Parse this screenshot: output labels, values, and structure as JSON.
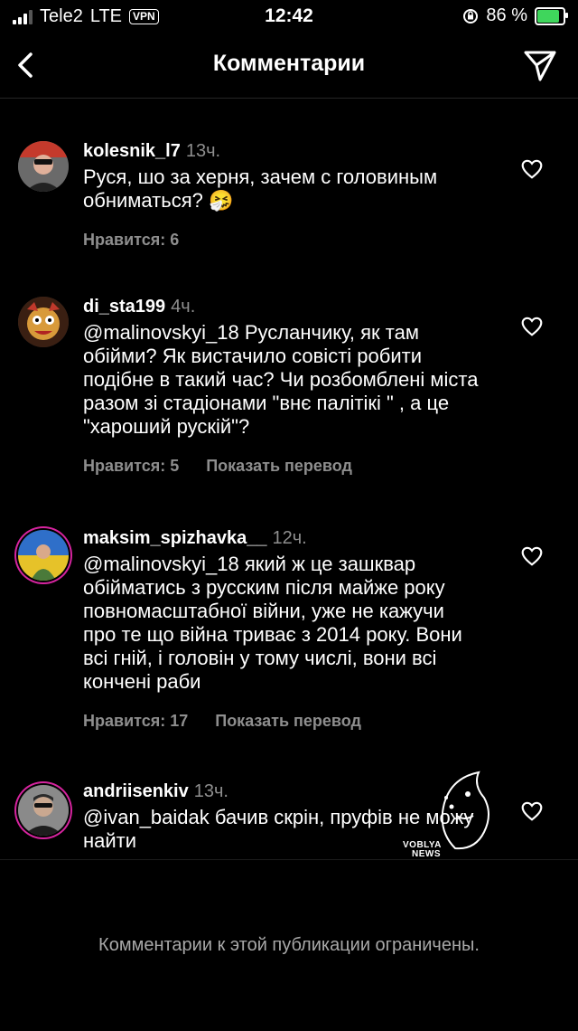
{
  "status_bar": {
    "carrier": "Tele2",
    "network": "LTE",
    "vpn": "VPN",
    "time": "12:42",
    "battery": "86 %",
    "battery_level": 0.86
  },
  "header": {
    "title": "Комментарии"
  },
  "comments": [
    {
      "username": "kolesnik_l7",
      "time": "13ч.",
      "text": "Руся, шо за херня, зачем с головиным обниматься? 🤧",
      "likes": "Нравится: 6",
      "translate": ""
    },
    {
      "username": "di_sta199",
      "time": "4ч.",
      "text": "@malinovskyi_18 Русланчику, як там обійми? Як вистачило совісті робити подібне в такий час? Чи розбомблені міста разом зі стадіонами \"внє палітікі \" , а це \"хароший рускій\"?",
      "likes": "Нравится: 5",
      "translate": "Показать перевод"
    },
    {
      "username": "maksim_spizhavka__",
      "time": "12ч.",
      "text": "@malinovskyi_18 який ж це зашквар обійматись з русским після майже року повномасштабної війни, уже не кажучи про те що війна триває з 2014 року. Вони всі гній, і головін у тому числі, вони всі кончені раби",
      "likes": "Нравится: 17",
      "translate": "Показать перевод"
    },
    {
      "username": "andriisenkiv",
      "time": "13ч.",
      "text": "@ivan_baidak бачив скрін, пруфів не можу найти",
      "likes": "",
      "translate": ""
    }
  ],
  "footer": {
    "note": "Комментарии к этой публикации ограничены."
  },
  "watermark": {
    "text_line1": "VOBLYA",
    "text_line2": "NEWS"
  },
  "icons": {
    "back": "chevron-left-icon",
    "share": "paper-plane-icon",
    "like": "heart-outline-icon"
  }
}
